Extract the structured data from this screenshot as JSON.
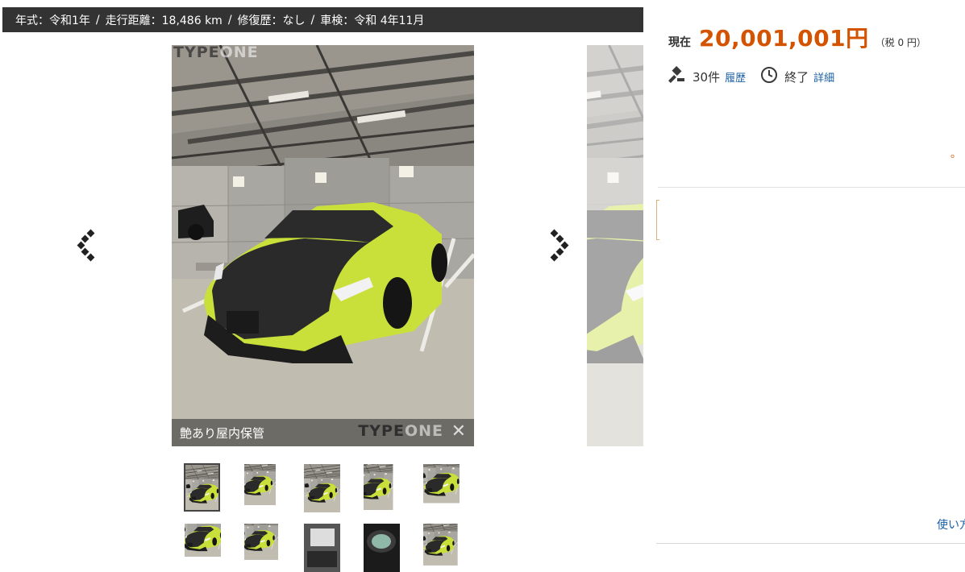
{
  "spec_bar": {
    "year_label": "年式：令和1年",
    "mileage_label": "走行距離：18,486 km",
    "repair_label": "修復歴：なし",
    "inspection_label": "車検：令和 4年11月",
    "separator": "/"
  },
  "gallery": {
    "caption": "艶あり屋内保管",
    "watermark_top_a": "TYPE",
    "watermark_top_b": "ONE",
    "watermark_bottom_a": "TYPE",
    "watermark_bottom_b": "ONE",
    "close_glyph": "✕",
    "thumbnails_count": 10,
    "active_thumbnail": 1
  },
  "price": {
    "label": "現在",
    "value": "20,001,001円",
    "tax_note": "（税 0 円）",
    "color": "#d45300"
  },
  "info": {
    "bids": "30件",
    "bids_link": "履歴",
    "status": "終了",
    "status_link": "詳細"
  },
  "footer": {
    "help_link": "使い方"
  },
  "icons": {
    "prev": "chevron-left-icon",
    "next": "chevron-right-icon",
    "bid": "gavel-icon",
    "time": "clock-icon",
    "close": "close-icon"
  },
  "colors": {
    "spec_bar_bg": "#333333",
    "price": "#d45300",
    "link": "#1a5fa6",
    "car_body": "#c9e03a"
  }
}
